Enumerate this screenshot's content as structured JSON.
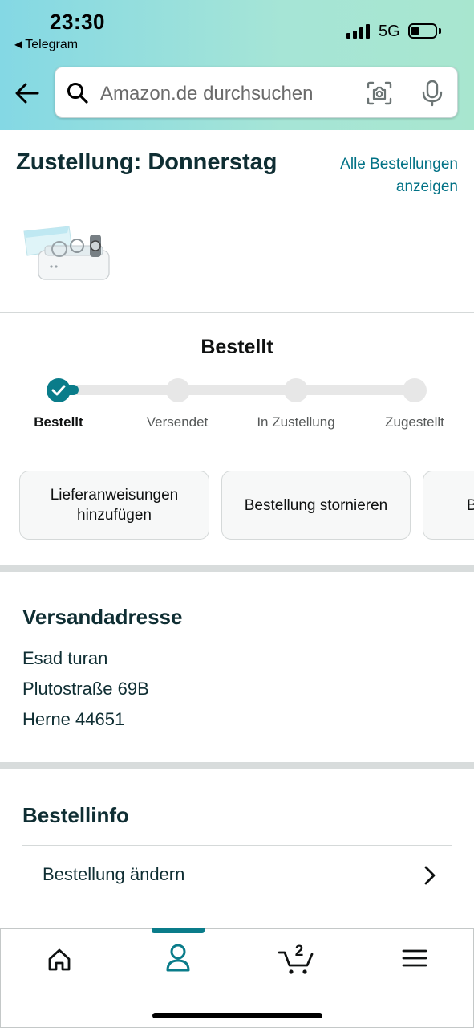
{
  "status_bar": {
    "time": "23:30",
    "back_app": "Telegram",
    "network": "5G"
  },
  "search": {
    "placeholder": "Amazon.de durchsuchen"
  },
  "delivery": {
    "title": "Zustellung: Donnerstag",
    "all_orders_line1": "Alle Bestellungen",
    "all_orders_line2": "anzeigen"
  },
  "tracking": {
    "status_title": "Bestellt",
    "progress_step": 1,
    "steps": [
      {
        "label": "Bestellt"
      },
      {
        "label": "Versendet"
      },
      {
        "label": "In Zustellung"
      },
      {
        "label": "Zugestellt"
      }
    ]
  },
  "actions": [
    {
      "line1": "Lieferanweisungen",
      "line2": "hinzufügen"
    },
    {
      "line1": "Bestellung stornieren",
      "line2": ""
    },
    {
      "line1": "B",
      "line2": ""
    }
  ],
  "shipping": {
    "heading": "Versandadresse",
    "name": "Esad turan",
    "street": "Plutostraße 69B",
    "city": "Herne 44651"
  },
  "order_info": {
    "heading": "Bestellinfo",
    "change_label": "Bestellung ändern"
  },
  "tabbar": {
    "cart_count": "2",
    "active_tab": "account"
  },
  "colors": {
    "accent": "#0a7c8a",
    "link": "#007185",
    "heading": "#0f2e33"
  }
}
